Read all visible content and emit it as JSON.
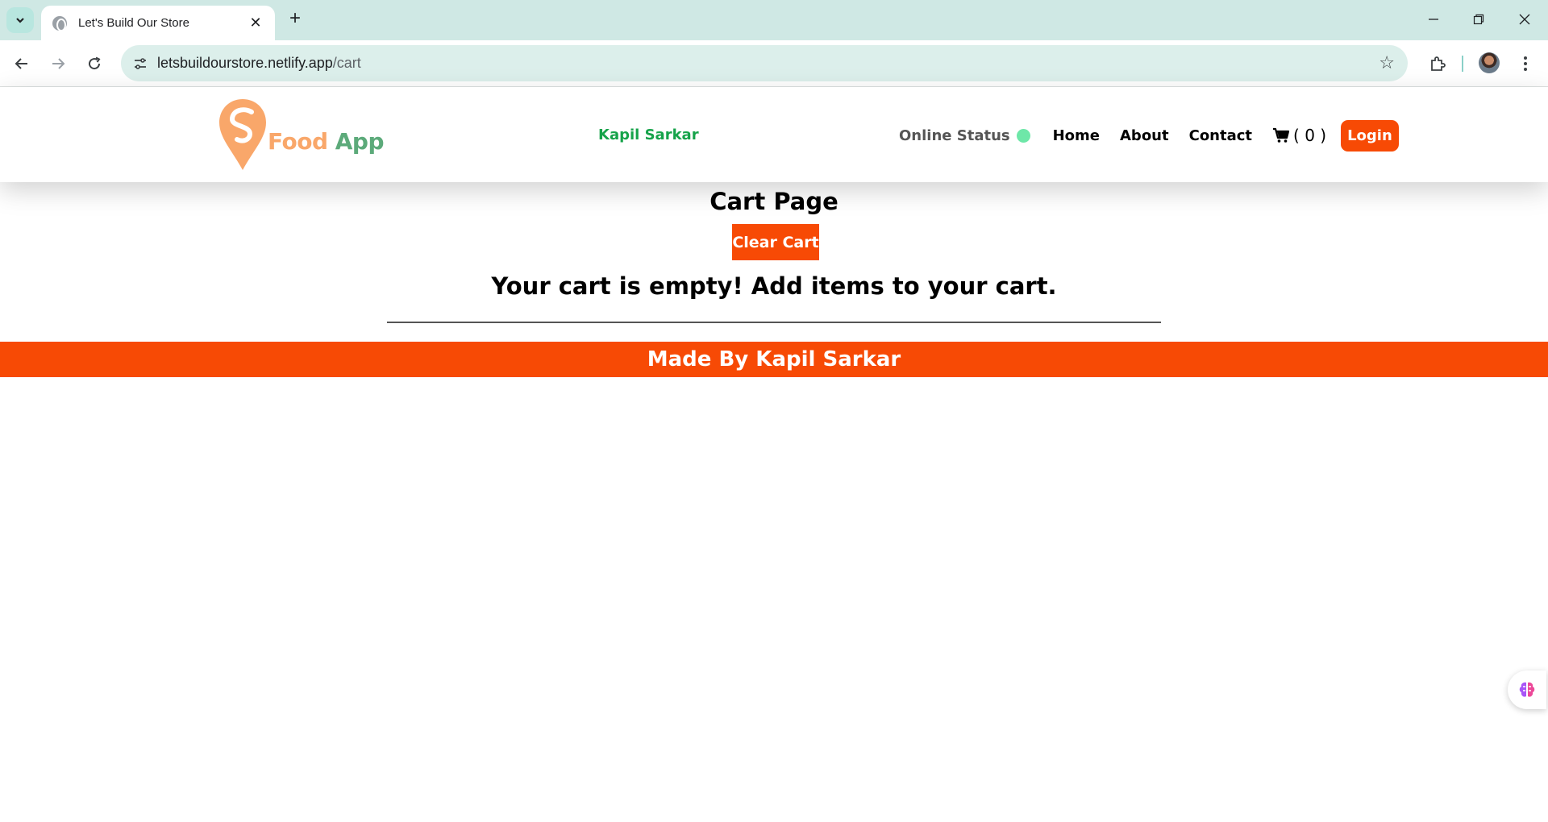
{
  "browser": {
    "tab_title": "Let's Build Our Store",
    "tab_close": "✕",
    "new_tab": "+",
    "url_host": "letsbuildourstore.netlify.app",
    "url_path": "/cart",
    "window_controls": [
      "minimize-icon",
      "restore-icon",
      "close-icon"
    ]
  },
  "header": {
    "logo_food": "Food",
    "logo_app": "App",
    "brand_name": "Kapil Sarkar",
    "online_status_label": "Online Status",
    "online_status_color": "#6ee7a8",
    "nav": {
      "home": "Home",
      "about": "About",
      "contact": "Contact"
    },
    "cart_count": "( 0 )",
    "login_label": "Login"
  },
  "cart": {
    "title": "Cart Page",
    "clear_label": "Clear Cart",
    "empty_message": "Your cart is empty! Add items to your cart."
  },
  "footer": {
    "text": "Made By Kapil Sarkar"
  },
  "colors": {
    "accent": "#f74a05",
    "brand_green": "#16a34a",
    "logo_orange": "#f9a76a",
    "logo_green": "#5caa7a"
  }
}
